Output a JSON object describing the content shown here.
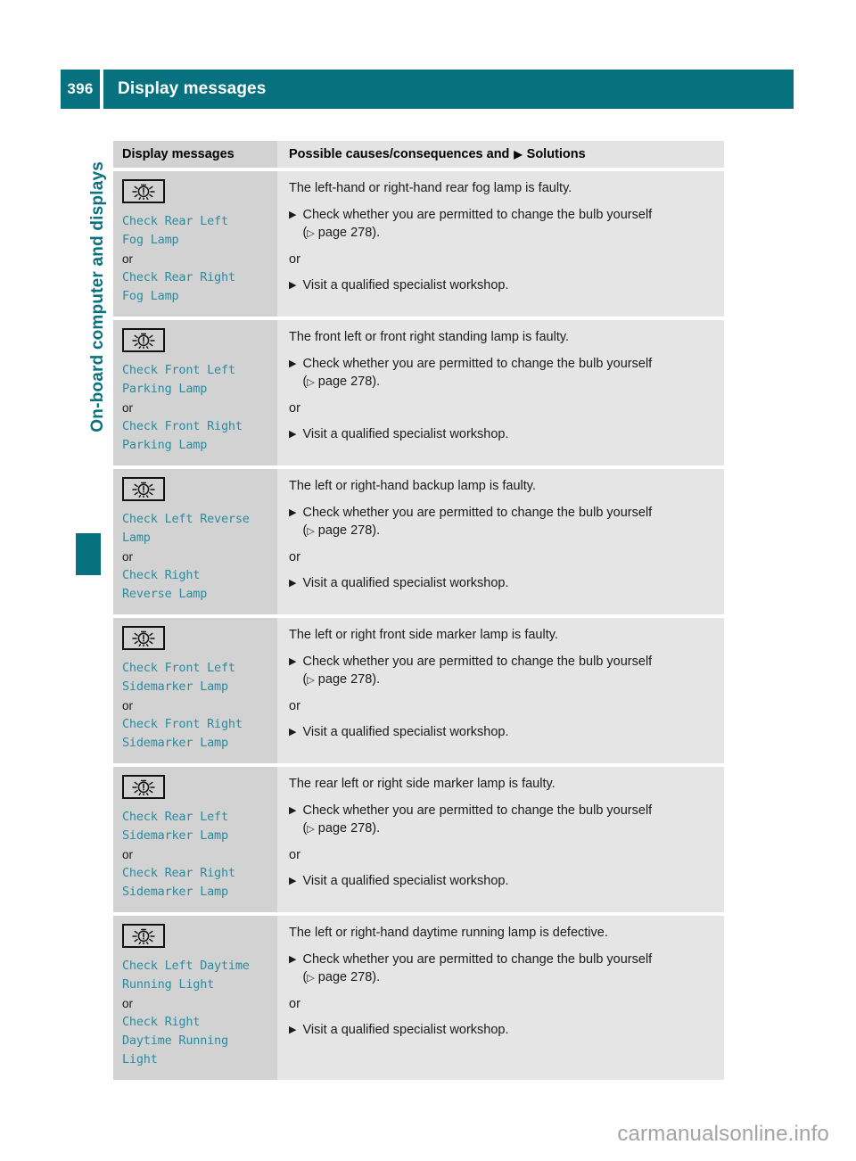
{
  "header": {
    "page_number": "396",
    "title": "Display messages"
  },
  "sidebar": {
    "chapter_label": "On-board computer and displays"
  },
  "table": {
    "columns": {
      "left": "Display messages",
      "right_prefix": "Possible causes/consequences and",
      "right_arrow": "▶",
      "right_suffix": "Solutions"
    },
    "rows": [
      {
        "icon": "lamp-warning-icon",
        "messages": [
          "Check Rear Left\nFog Lamp",
          "Check Rear Right\nFog Lamp"
        ],
        "or_label": "or",
        "cause": "The left-hand or right-hand rear fog lamp is faulty.",
        "solutions": [
          {
            "arrow": "▶",
            "text": "Check whether you are permitted to change the bulb yourself",
            "sub_arrow": "▷",
            "sub_text": "page 278)."
          },
          {
            "arrow": "▶",
            "text": "Visit a qualified specialist workshop.",
            "sub_arrow": "",
            "sub_text": ""
          }
        ],
        "solution_or": "or"
      },
      {
        "icon": "lamp-warning-icon",
        "messages": [
          "Check Front Left\nParking Lamp",
          "Check Front Right\nParking Lamp"
        ],
        "or_label": "or",
        "cause": "The front left or front right standing lamp is faulty.",
        "solutions": [
          {
            "arrow": "▶",
            "text": "Check whether you are permitted to change the bulb yourself",
            "sub_arrow": "▷",
            "sub_text": "page 278)."
          },
          {
            "arrow": "▶",
            "text": "Visit a qualified specialist workshop.",
            "sub_arrow": "",
            "sub_text": ""
          }
        ],
        "solution_or": "or"
      },
      {
        "icon": "lamp-warning-icon",
        "messages": [
          "Check Left Reverse\nLamp",
          "Check Right\nReverse Lamp"
        ],
        "or_label": "or",
        "cause": "The left or right-hand backup lamp is faulty.",
        "solutions": [
          {
            "arrow": "▶",
            "text": "Check whether you are permitted to change the bulb yourself",
            "sub_arrow": "▷",
            "sub_text": "page 278)."
          },
          {
            "arrow": "▶",
            "text": "Visit a qualified specialist workshop.",
            "sub_arrow": "",
            "sub_text": ""
          }
        ],
        "solution_or": "or"
      },
      {
        "icon": "lamp-warning-icon",
        "messages": [
          "Check Front Left\nSidemarker Lamp",
          "Check Front Right\nSidemarker Lamp"
        ],
        "or_label": "or",
        "cause": "The left or right front side marker lamp is faulty.",
        "solutions": [
          {
            "arrow": "▶",
            "text": "Check whether you are permitted to change the bulb yourself",
            "sub_arrow": "▷",
            "sub_text": "page 278)."
          },
          {
            "arrow": "▶",
            "text": "Visit a qualified specialist workshop.",
            "sub_arrow": "",
            "sub_text": ""
          }
        ],
        "solution_or": "or"
      },
      {
        "icon": "lamp-warning-icon",
        "messages": [
          "Check Rear Left\nSidemarker Lamp",
          "Check Rear Right\nSidemarker Lamp"
        ],
        "or_label": "or",
        "cause": "The rear left or right side marker lamp is faulty.",
        "solutions": [
          {
            "arrow": "▶",
            "text": "Check whether you are permitted to change the bulb yourself",
            "sub_arrow": "▷",
            "sub_text": "page 278)."
          },
          {
            "arrow": "▶",
            "text": "Visit a qualified specialist workshop.",
            "sub_arrow": "",
            "sub_text": ""
          }
        ],
        "solution_or": "or"
      },
      {
        "icon": "lamp-warning-icon",
        "messages": [
          "Check Left Daytime\nRunning Light",
          "Check Right\nDaytime Running\nLight"
        ],
        "or_label": "or",
        "cause": "The left or right-hand daytime running lamp is defective.",
        "solutions": [
          {
            "arrow": "▶",
            "text": "Check whether you are permitted to change the bulb yourself",
            "sub_arrow": "▷",
            "sub_text": "page 278)."
          },
          {
            "arrow": "▶",
            "text": "Visit a qualified specialist workshop.",
            "sub_arrow": "",
            "sub_text": ""
          }
        ],
        "solution_or": "or"
      }
    ]
  },
  "watermark": "carmanualsonline.info",
  "colors": {
    "teal": "#07717f",
    "message_text": "#2c8a9e",
    "row_left_bg": "#d2d2d2",
    "row_right_bg": "#e5e5e5",
    "header_row_bg": "#d2d2d2"
  }
}
